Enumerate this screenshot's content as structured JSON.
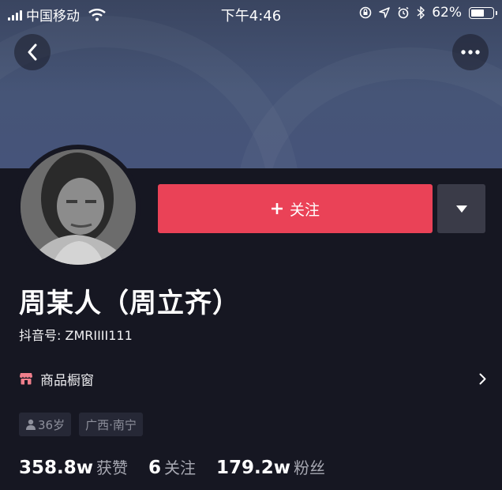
{
  "status_bar": {
    "carrier": "中国移动",
    "time": "下午4:46",
    "battery": "62%",
    "battery_level": 0.62,
    "icons": [
      "signal-icon",
      "wifi-icon",
      "orientation-lock-icon",
      "location-icon",
      "alarm-icon",
      "bluetooth-icon",
      "battery-icon"
    ]
  },
  "nav": {
    "back_icon": "chevron-left-icon",
    "more_icon": "more-dots-icon"
  },
  "profile": {
    "follow_label": "关注",
    "follow_icon": "plus-icon",
    "dropdown_icon": "triangle-down-icon",
    "name": "周某人（周立齐）",
    "douyin_id": "抖音号: ZMRIIII111",
    "shop_label": "商品橱窗",
    "shop_icon": "storefront-icon",
    "tags": [
      {
        "icon": "person-icon",
        "text": "36岁"
      },
      {
        "text": "广西·南宁"
      }
    ]
  },
  "stats": [
    {
      "value": "358.8w",
      "label": "获赞"
    },
    {
      "value": "6",
      "label": "关注"
    },
    {
      "value": "179.2w",
      "label": "粉丝"
    }
  ],
  "colors": {
    "background": "#161722",
    "banner": "#46547a",
    "follow_button": "#ea4257",
    "secondary_button": "#3a3b48",
    "tag_bg": "#262836",
    "muted_text": "#a7a8b2"
  }
}
